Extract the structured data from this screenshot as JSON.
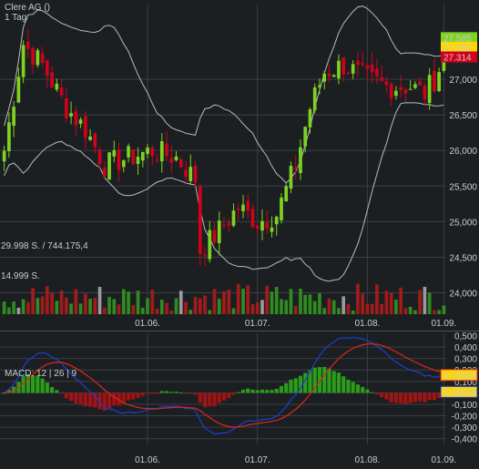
{
  "header": {
    "title": "Clere AG ()",
    "interval": "1 Tag"
  },
  "colors": {
    "background": "#1c1f22",
    "grid": "#3a3e43",
    "up": "#7ed321",
    "down": "#d0021b",
    "band": "#b7bbc0",
    "volume_up": "#2f8c1f",
    "volume_down": "#a31b1b",
    "volume_neutral": "#9a9a9a",
    "macd_line": "#1a3fd6",
    "signal_line": "#e0261e",
    "hist_pos": "#2a9d1a",
    "hist_neg": "#a31313",
    "label_last": "#7ed321",
    "label_mid": "#ffd800",
    "label_low": "#d0021b"
  },
  "chart_data": [
    {
      "type": "candlestick",
      "title": "Clere AG ()",
      "subtitle": "1 Tag",
      "x_ticks": [
        "01.06.",
        "01.07.",
        "01.08.",
        "01.09."
      ],
      "y_ticks": [
        24000,
        24500,
        25000,
        25500,
        26000,
        26500,
        27000
      ],
      "ylim": [
        23700,
        28050
      ],
      "last_labels": [
        27585,
        27450,
        27314
      ],
      "overlays": [
        "Bollinger Bands"
      ],
      "anchors_close": [
        [
          0,
          26.0
        ],
        [
          4,
          27.5
        ],
        [
          8,
          27.2
        ],
        [
          13,
          26.6
        ],
        [
          17,
          26.3
        ],
        [
          21,
          25.8
        ],
        [
          26,
          25.9
        ],
        [
          31,
          26.0
        ],
        [
          36,
          25.9
        ],
        [
          40,
          25.6
        ],
        [
          41,
          24.6
        ],
        [
          44,
          24.8
        ],
        [
          49,
          25.2
        ],
        [
          53,
          25.0
        ],
        [
          57,
          25.1
        ],
        [
          61,
          25.8
        ],
        [
          64,
          26.6
        ],
        [
          67,
          27.1
        ],
        [
          71,
          27.2
        ],
        [
          76,
          27.0
        ],
        [
          80,
          26.9
        ],
        [
          85,
          26.9
        ],
        [
          88,
          26.8
        ],
        [
          90,
          27.0
        ],
        [
          92,
          27.3
        ]
      ]
    },
    {
      "type": "bar",
      "series": [
        {
          "name": "Volumen",
          "values": []
        }
      ],
      "labels": [
        "29.998 S. / 744.175,4",
        "14.999 S."
      ]
    },
    {
      "type": "line",
      "title": "MACD: 12 | 26 | 9",
      "y_ticks": [
        -0.4,
        -0.3,
        -0.2,
        -0.1,
        0.0,
        0.1,
        0.2,
        0.3,
        0.4
      ],
      "y_tick_labels": [
        "-0,400",
        "-0,300",
        "-0,200",
        "-0,100",
        "0,000",
        "0,100",
        "0,200",
        "0,300",
        "0,400",
        "0,500"
      ],
      "ylim": [
        -0.45,
        0.52
      ],
      "last_labels": [
        0.15568,
        0.00836
      ],
      "last_label_text": [
        "0,15568",
        "0,00836"
      ],
      "x_ticks": [
        "01.06.",
        "01.07.",
        "01.08.",
        "01.09."
      ]
    }
  ]
}
